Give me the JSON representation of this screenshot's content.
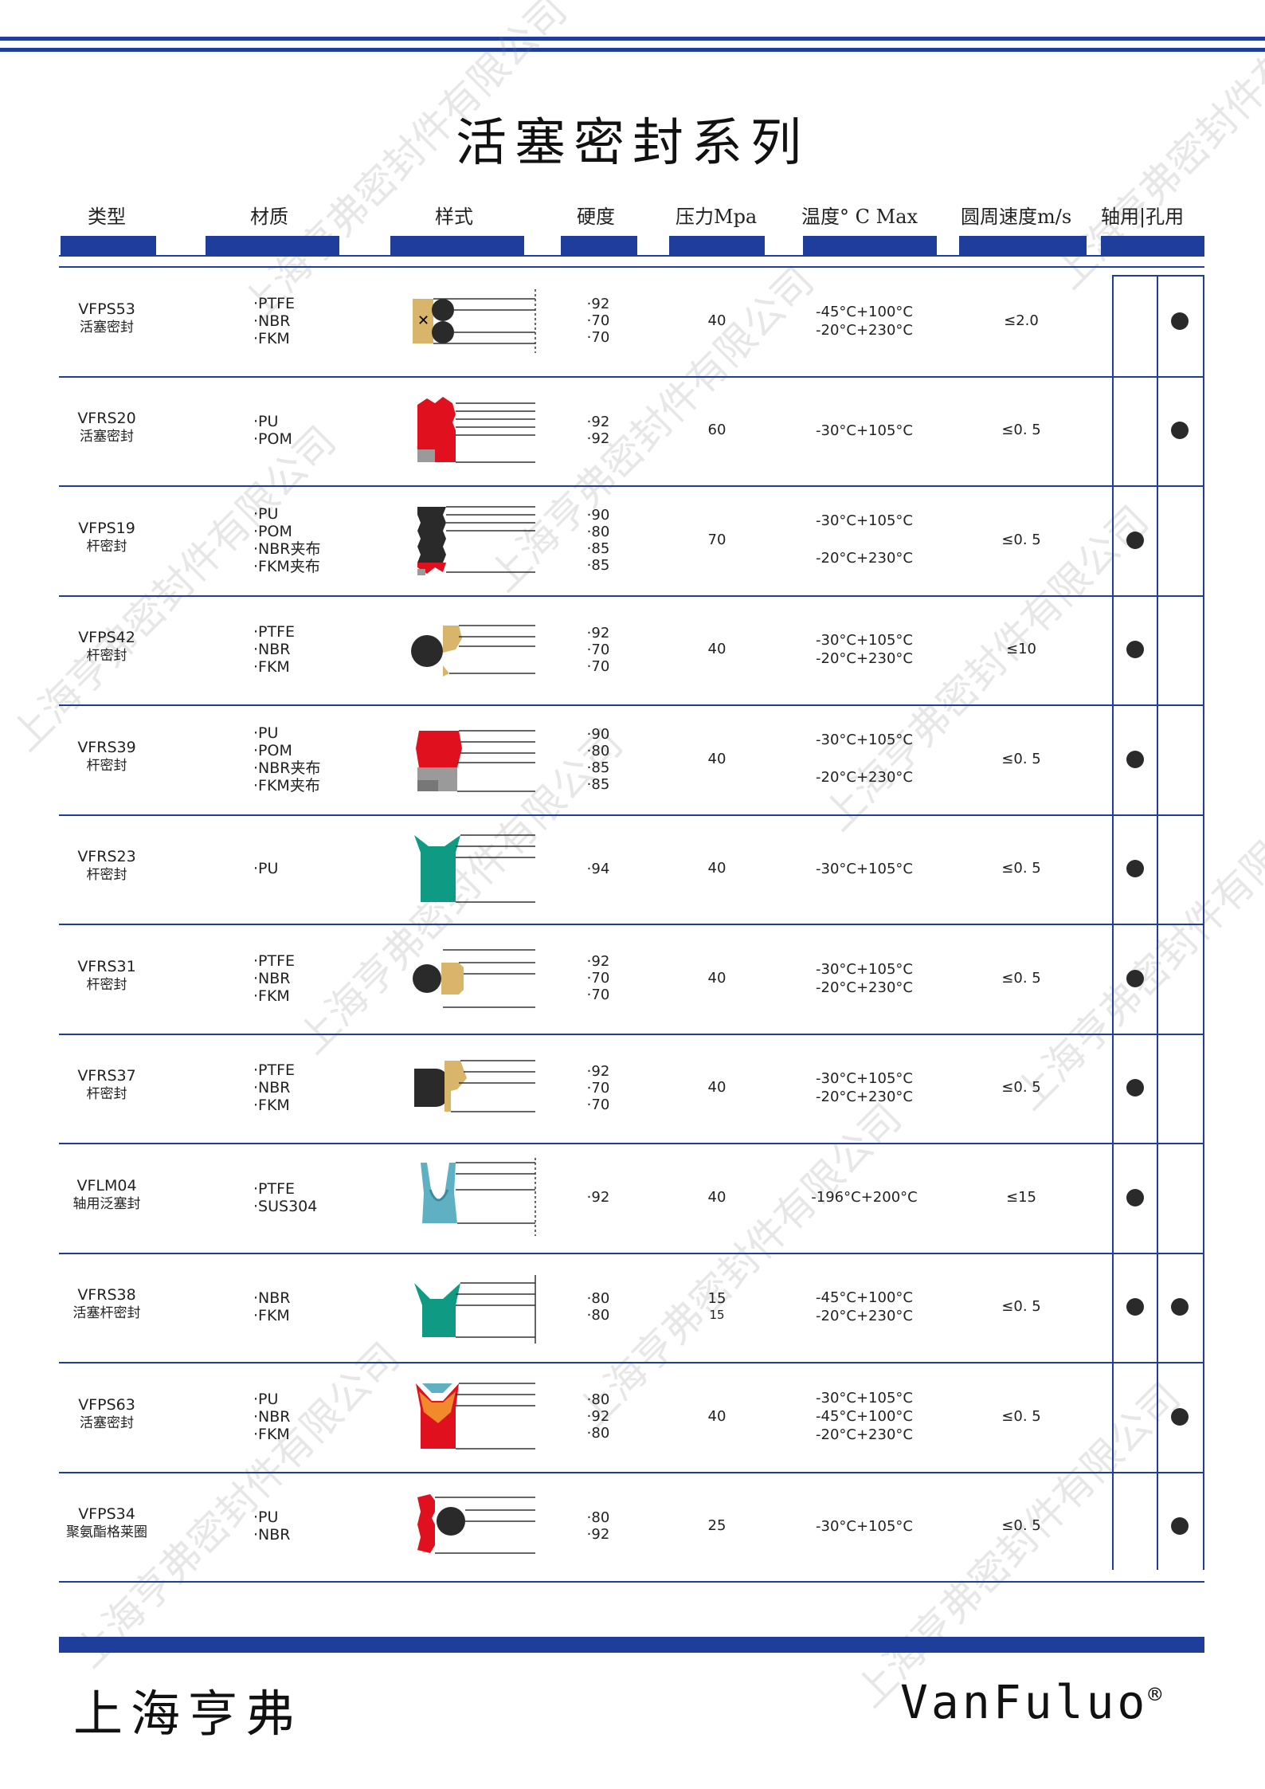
{
  "page_title": "活塞密封系列",
  "headers": [
    "类型",
    "材质",
    "样式",
    "硬度",
    "压力Mpa",
    "温度° C  Max",
    "圆周速度m/s",
    "轴用|孔用"
  ],
  "rows": [
    {
      "model": "VFPS53",
      "name": "活塞密封",
      "materials": [
        "·PTFE",
        "·NBR",
        "·FKM"
      ],
      "hardness": [
        "·92",
        "·70",
        "·70"
      ],
      "pressure": "40",
      "temps": [
        "-45°C+100°C",
        "-20°C+230°C"
      ],
      "speed": "≤2.0",
      "shaft": false,
      "bore": true
    },
    {
      "model": "VFRS20",
      "name": "活塞密封",
      "materials": [
        "·PU",
        "·POM"
      ],
      "hardness": [
        "·92",
        "·92"
      ],
      "pressure": "60",
      "temps": [
        "-30°C+105°C"
      ],
      "speed": "≤0. 5",
      "shaft": false,
      "bore": true
    },
    {
      "model": "VFPS19",
      "name": "杆密封",
      "materials": [
        "·PU",
        "·POM",
        "·NBR夹布",
        "·FKM夹布"
      ],
      "hardness": [
        "·90",
        "·80",
        "·85",
        "·85"
      ],
      "pressure": "70",
      "temps": [
        "-30°C+105°C",
        "-20°C+230°C"
      ],
      "speed": "≤0. 5",
      "shaft": true,
      "bore": false
    },
    {
      "model": "VFPS42",
      "name": "杆密封",
      "materials": [
        "·PTFE",
        "·NBR",
        "·FKM"
      ],
      "hardness": [
        "·92",
        "·70",
        "·70"
      ],
      "pressure": "40",
      "temps": [
        "-30°C+105°C",
        "-20°C+230°C"
      ],
      "speed": "≤10",
      "shaft": true,
      "bore": false
    },
    {
      "model": "VFRS39",
      "name": "杆密封",
      "materials": [
        "·PU",
        "·POM",
        "·NBR夹布",
        "·FKM夹布"
      ],
      "hardness": [
        "·90",
        "·80",
        "·85",
        "·85"
      ],
      "pressure": "40",
      "temps": [
        "-30°C+105°C",
        "-20°C+230°C"
      ],
      "speed": "≤0. 5",
      "shaft": true,
      "bore": false
    },
    {
      "model": "VFRS23",
      "name": "杆密封",
      "materials": [
        "·PU"
      ],
      "hardness": [
        "·94"
      ],
      "pressure": "40",
      "temps": [
        "-30°C+105°C"
      ],
      "speed": "≤0. 5",
      "shaft": true,
      "bore": false
    },
    {
      "model": "VFRS31",
      "name": "杆密封",
      "materials": [
        "·PTFE",
        "·NBR",
        "·FKM"
      ],
      "hardness": [
        "·92",
        "·70",
        "·70"
      ],
      "pressure": "40",
      "temps": [
        "-30°C+105°C",
        "-20°C+230°C"
      ],
      "speed": "≤0. 5",
      "shaft": true,
      "bore": false
    },
    {
      "model": "VFRS37",
      "name": "杆密封",
      "materials": [
        "·PTFE",
        "·NBR",
        "·FKM"
      ],
      "hardness": [
        "·92",
        "·70",
        "·70"
      ],
      "pressure": "40",
      "temps": [
        "-30°C+105°C",
        "-20°C+230°C"
      ],
      "speed": "≤0. 5",
      "shaft": true,
      "bore": false
    },
    {
      "model": "VFLM04",
      "name": "轴用泛塞封",
      "materials": [
        "·PTFE",
        "·SUS304"
      ],
      "hardness": [
        "·92"
      ],
      "pressure": "40",
      "temps": [
        "-196°C+200°C"
      ],
      "speed": "≤15",
      "shaft": true,
      "bore": false
    },
    {
      "model": "VFRS38",
      "name": "活塞杆密封",
      "materials": [
        "·NBR",
        "·FKM"
      ],
      "hardness": [
        "·80",
        "·80"
      ],
      "pressure": "15",
      "pressure2": "15",
      "temps": [
        "-45°C+100°C",
        "-20°C+230°C"
      ],
      "speed": "≤0. 5",
      "shaft": true,
      "bore": true
    },
    {
      "model": "VFPS63",
      "name": "活塞密封",
      "materials": [
        "·PU",
        "·NBR",
        "·FKM"
      ],
      "hardness": [
        "·80",
        "·92",
        "·80"
      ],
      "pressure": "40",
      "temps": [
        "-30°C+105°C",
        "-45°C+100°C",
        "-20°C+230°C"
      ],
      "speed": "≤0. 5",
      "shaft": false,
      "bore": true
    },
    {
      "model": "VFPS34",
      "name": "聚氨酯格莱圈",
      "materials": [
        "·PU",
        "·NBR"
      ],
      "hardness": [
        "·80",
        "·92"
      ],
      "pressure": "25",
      "temps": [
        "-30°C+105°C"
      ],
      "speed": "≤0. 5",
      "shaft": false,
      "bore": true
    }
  ],
  "footer": {
    "company_cn": "上海亨弗",
    "brand": "VanFuluo",
    "reg_mark": "®"
  },
  "watermark": "上海亨弗密封件有限公司",
  "colors": {
    "blue": "#1f3e9c",
    "tan": "#d9b56b",
    "red": "#e0101e",
    "teal": "#0f9a84",
    "lightblue": "#5fb0c2",
    "orange": "#f08a2a",
    "dark": "#2a2a2a",
    "grey": "#9a9a9a"
  }
}
